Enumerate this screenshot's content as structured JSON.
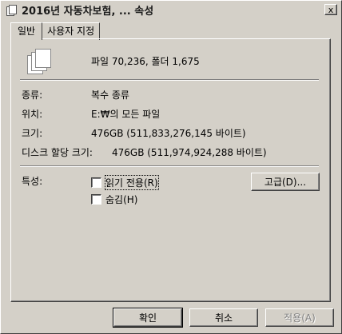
{
  "window": {
    "title": "2016년 자동차보험, ... 속성",
    "close_label": "x"
  },
  "tabs": [
    {
      "label": "일반",
      "active": true
    },
    {
      "label": "사용자 지정",
      "active": false
    }
  ],
  "summary": {
    "icon": "multiple-files-icon",
    "text": "파일 70,236, 폴더 1,675"
  },
  "properties": {
    "type_label": "종류:",
    "type_value": "복수 종류",
    "location_label": "위치:",
    "location_value": "E:₩의 모든 파일",
    "size_label": "크기:",
    "size_value": "476GB (511,833,276,145 바이트)",
    "disk_size_label": "디스크 할당 크기:",
    "disk_size_value": "476GB (511,974,924,288 바이트)"
  },
  "attributes": {
    "label": "특성:",
    "readonly_label": "읽기 전용(R)",
    "readonly_checked": false,
    "hidden_label": "숨김(H)",
    "hidden_checked": false,
    "advanced_label": "고급(D)..."
  },
  "footer": {
    "ok_label": "확인",
    "cancel_label": "취소",
    "apply_label": "적용(A)"
  }
}
